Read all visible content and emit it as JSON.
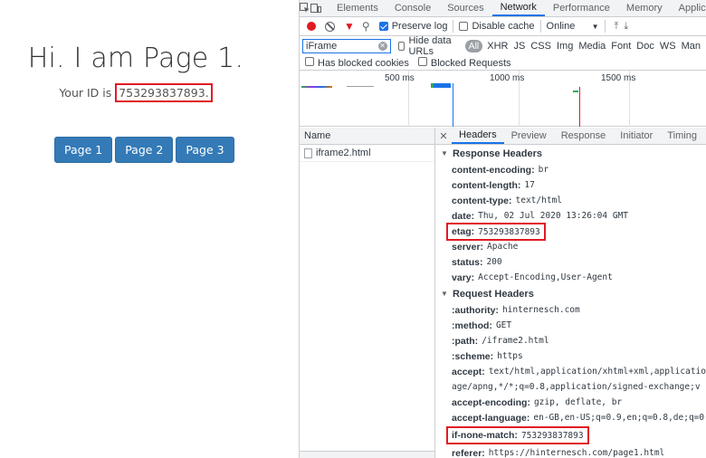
{
  "page": {
    "heading": "Hi. I am Page 1.",
    "id_prefix": "Your ID is ",
    "id_value": "753293837893",
    "id_suffix": ".",
    "buttons": [
      "Page 1",
      "Page 2",
      "Page 3"
    ]
  },
  "devtools": {
    "tabs": [
      "Elements",
      "Console",
      "Sources",
      "Network",
      "Performance",
      "Memory",
      "Application"
    ],
    "active_tab": "Network",
    "toolbar": {
      "preserve_log": "Preserve log",
      "disable_cache": "Disable cache",
      "throttle": "Online"
    },
    "filter": {
      "value": "iFrame",
      "hide_data_urls": "Hide data URLs",
      "all": "All",
      "types": [
        "XHR",
        "JS",
        "CSS",
        "Img",
        "Media",
        "Font",
        "Doc",
        "WS",
        "Man"
      ]
    },
    "filter2": {
      "blocked_cookies": "Has blocked cookies",
      "blocked_requests": "Blocked Requests"
    },
    "timeline_labels": [
      "500 ms",
      "1000 ms",
      "1500 ms"
    ],
    "requests_header": "Name",
    "requests": [
      "iframe2.html"
    ],
    "detail_tabs": [
      "Headers",
      "Preview",
      "Response",
      "Initiator",
      "Timing"
    ],
    "response_title": "Response Headers",
    "response_headers": [
      {
        "k": "content-encoding:",
        "v": "br"
      },
      {
        "k": "content-length:",
        "v": "17"
      },
      {
        "k": "content-type:",
        "v": "text/html"
      },
      {
        "k": "date:",
        "v": "Thu, 02 Jul 2020 13:26:04 GMT"
      },
      {
        "k": "etag:",
        "v": "753293837893"
      },
      {
        "k": "server:",
        "v": "Apache"
      },
      {
        "k": "status:",
        "v": "200"
      },
      {
        "k": "vary:",
        "v": "Accept-Encoding,User-Agent"
      }
    ],
    "request_title": "Request Headers",
    "request_headers": [
      {
        "k": ":authority:",
        "v": "hinternesch.com"
      },
      {
        "k": ":method:",
        "v": "GET"
      },
      {
        "k": ":path:",
        "v": "/iframe2.html"
      },
      {
        "k": ":scheme:",
        "v": "https"
      },
      {
        "k": "accept:",
        "v": "text/html,application/xhtml+xml,applicatio"
      },
      {
        "k": "",
        "v": "age/apng,*/*;q=0.8,application/signed-exchange;v"
      },
      {
        "k": "accept-encoding:",
        "v": "gzip, deflate, br"
      },
      {
        "k": "accept-language:",
        "v": "en-GB,en-US;q=0.9,en;q=0.8,de;q=0"
      },
      {
        "k": "if-none-match:",
        "v": "753293837893"
      },
      {
        "k": "referer:",
        "v": "https://hinternesch.com/page1.html"
      }
    ]
  }
}
